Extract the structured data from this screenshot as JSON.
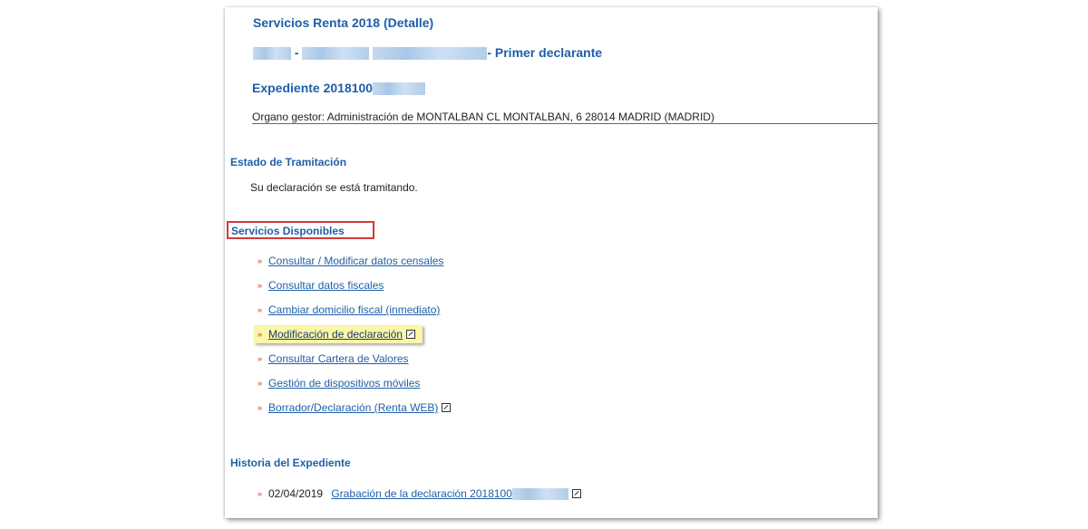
{
  "header": {
    "title": "Servicios Renta 2018 (Detalle)",
    "dash": "-",
    "declarant_suffix": "- Primer declarante",
    "expediente_prefix": "Expediente 2018100",
    "organo": "Organo gestor: Administración de MONTALBAN  CL MONTALBAN, 6 28014 MADRID (MADRID)"
  },
  "estado": {
    "heading": "Estado de Tramitación",
    "text": "Su declaración se está tramitando."
  },
  "servicios": {
    "heading": "Servicios Disponibles",
    "items": [
      {
        "label": "Consultar / Modificar datos censales"
      },
      {
        "label": "Consultar datos fiscales"
      },
      {
        "label": "Cambiar domicilio fiscal (inmediato)"
      },
      {
        "label": "Modificación de declaración"
      },
      {
        "label": "Consultar Cartera de Valores"
      },
      {
        "label": "Gestión de dispositivos móviles"
      },
      {
        "label": "Borrador/Declaración (Renta WEB)"
      }
    ]
  },
  "historia": {
    "heading": "Historia del Expediente",
    "date": "02/04/2019",
    "entry_prefix": "Grabación de la declaración 2018100"
  },
  "icons": {
    "bullet": "double-arrow-bullet-icon",
    "external": "external-link-icon"
  },
  "colors": {
    "title_blue": "#1f5fa8",
    "bullet_red": "#c0392b",
    "highlight": "#fbf6a8",
    "red_box": "#d23a3a"
  }
}
